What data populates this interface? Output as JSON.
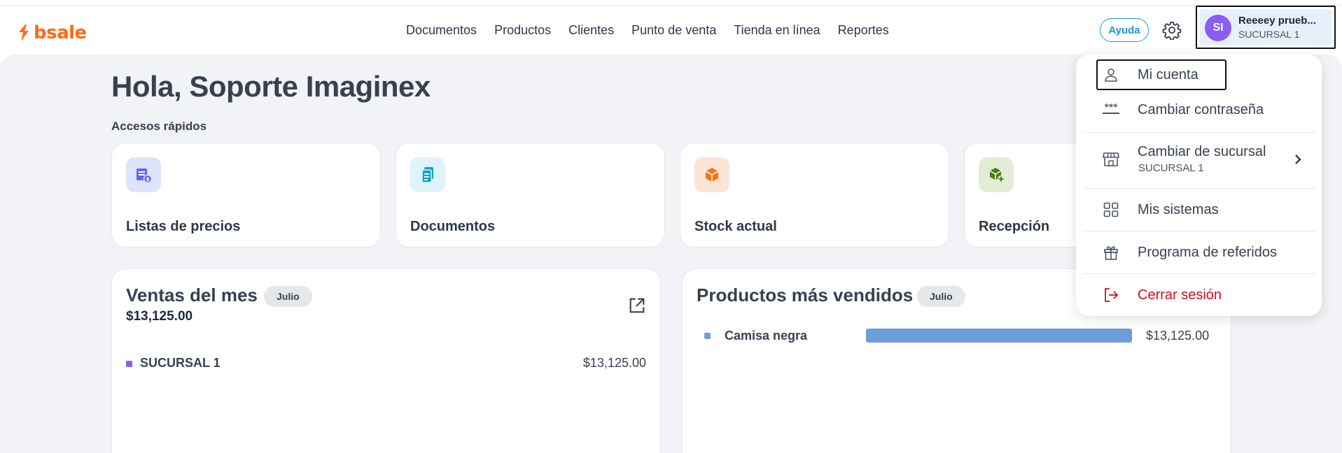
{
  "brand": {
    "name": "bsale",
    "color": "#ff6a13"
  },
  "nav": {
    "items": [
      {
        "label": "Documentos"
      },
      {
        "label": "Productos"
      },
      {
        "label": "Clientes"
      },
      {
        "label": "Punto de venta"
      },
      {
        "label": "Tienda en línea"
      },
      {
        "label": "Reportes"
      }
    ]
  },
  "header": {
    "help_label": "Ayuda",
    "settings_icon": "gear-icon",
    "user": {
      "initials": "SI",
      "name": "Reeeey prueb...",
      "branch": "SUCURSAL 1",
      "avatar_color": "#8b5cf6"
    }
  },
  "main": {
    "greeting": "Hola, Soporte Imaginex",
    "quick_access_title": "Accesos rápidos",
    "quick_access": [
      {
        "label": "Listas de precios",
        "icon": "price-list-icon",
        "color": "#6366f1"
      },
      {
        "label": "Documentos",
        "icon": "document-icon",
        "color": "#0ea5c6"
      },
      {
        "label": "Stock actual",
        "icon": "box-icon",
        "color": "#f97316"
      },
      {
        "label": "Recepción",
        "icon": "box-add-icon",
        "color": "#4d7c0f"
      }
    ],
    "sales_panel": {
      "title": "Ventas del mes",
      "period": "Julio",
      "total": "$13,125.00",
      "rows": [
        {
          "label": "SUCURSAL 1",
          "value": "$13,125.00",
          "color": "#8b5cf6"
        }
      ]
    },
    "products_panel": {
      "title": "Productos más vendidos",
      "period": "Julio",
      "rows": [
        {
          "label": "Camisa negra",
          "value": "$13,125.00",
          "share": 1.0,
          "color": "#6b9edb"
        }
      ]
    }
  },
  "user_menu": {
    "items": [
      {
        "label": "Mi cuenta",
        "icon": "user-icon"
      },
      {
        "label": "Cambiar contraseña",
        "icon": "password-icon"
      },
      {
        "label": "Cambiar de sucursal",
        "sublabel": "SUCURSAL 1",
        "icon": "store-icon"
      },
      {
        "label": "Mis sistemas",
        "icon": "grid-icon"
      },
      {
        "label": "Programa de referidos",
        "icon": "gift-icon"
      },
      {
        "label": "Cerrar sesión",
        "icon": "logout-icon",
        "color": "#c8102e"
      }
    ]
  }
}
